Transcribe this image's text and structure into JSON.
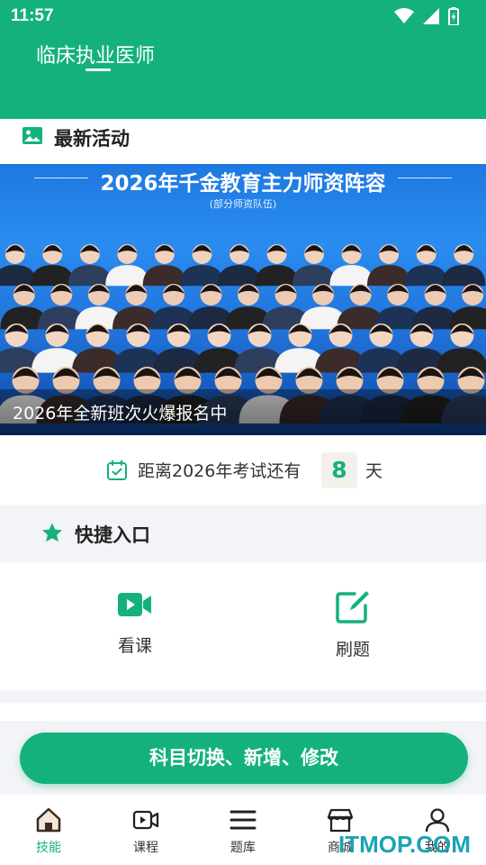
{
  "status_bar": {
    "time": "11:57"
  },
  "header": {
    "title": "临床执业医师"
  },
  "activity": {
    "title": "最新活动",
    "banner": {
      "title": "2026年千金教育主力师资阵容",
      "subtitle": "(部分师资队伍)",
      "caption": "2026年全新班次火爆报名中"
    }
  },
  "countdown": {
    "label": "距离2026年考试还有",
    "days": "8",
    "unit": "天"
  },
  "shortcuts": {
    "title": "快捷入口",
    "items": [
      {
        "label": "看课",
        "icon": "video-icon"
      },
      {
        "label": "刷题",
        "icon": "edit-icon"
      }
    ]
  },
  "subject_button": {
    "label": "科目切换、新增、修改"
  },
  "tabbar": {
    "items": [
      {
        "label": "技能",
        "icon": "home-icon",
        "active": true
      },
      {
        "label": "课程",
        "icon": "video-icon",
        "active": false
      },
      {
        "label": "题库",
        "icon": "menu-icon",
        "active": false
      },
      {
        "label": "商城",
        "icon": "store-icon",
        "active": false
      },
      {
        "label": "我的",
        "icon": "user-icon",
        "active": false
      }
    ]
  },
  "watermark": "ITMOP.COM",
  "colors": {
    "primary": "#14b27a",
    "header_bg": "#14b27a",
    "page_bg": "#f2f4f7"
  }
}
